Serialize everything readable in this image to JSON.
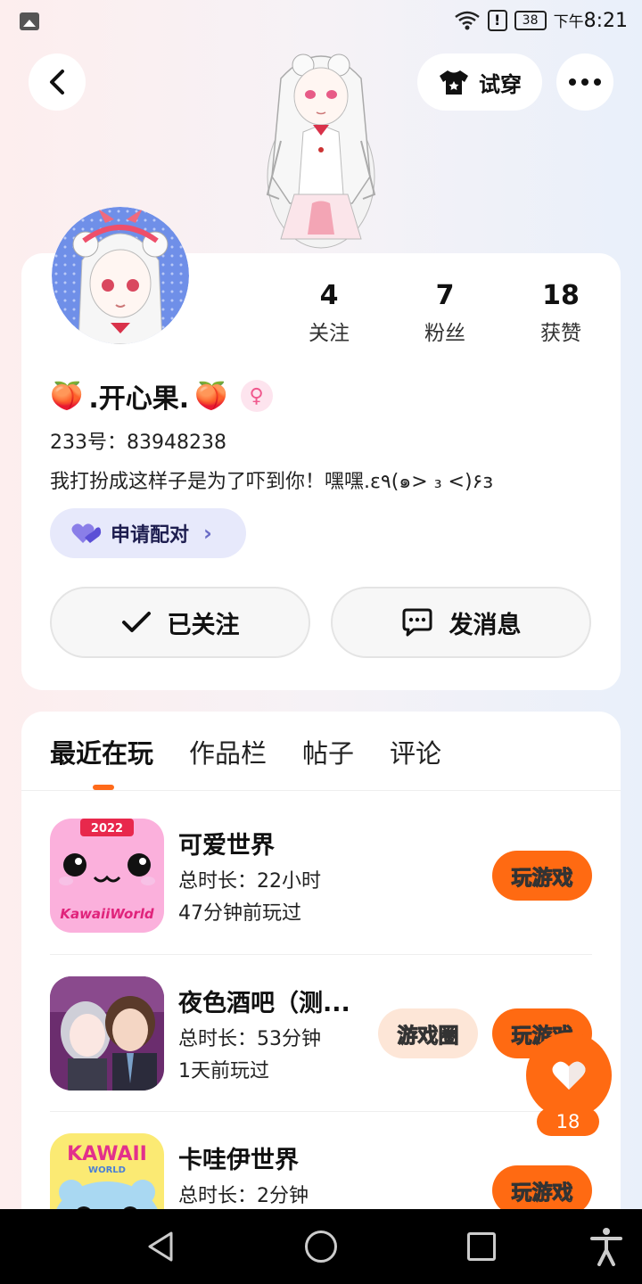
{
  "status_bar": {
    "time_prefix": "下午",
    "time": "8:21",
    "battery": "38",
    "alert": "!"
  },
  "header": {
    "try_on_label": "试穿",
    "icons": [
      "back-icon",
      "tshirt-icon",
      "more-icon"
    ]
  },
  "profile": {
    "stats": [
      {
        "value": "4",
        "label": "关注"
      },
      {
        "value": "7",
        "label": "粉丝"
      },
      {
        "value": "18",
        "label": "获赞"
      }
    ],
    "name_emoji": "🍑",
    "name": ".开心果.",
    "gender_symbol": "♀",
    "uid": "233号：83948238",
    "bio": "我打扮成这样子是为了吓到你！嘿嘿.ε٩(๑> ₃ <)۶з",
    "pair_label": "申请配对",
    "follow_label": "已关注",
    "message_label": "发消息"
  },
  "tabs": [
    {
      "label": "最近在玩",
      "active": true
    },
    {
      "label": "作品栏",
      "active": false
    },
    {
      "label": "帖子",
      "active": false
    },
    {
      "label": "评论",
      "active": false
    }
  ],
  "games": [
    {
      "title": "可爱世界",
      "duration": "总时长：22小时",
      "last_played": "47分钟前玩过",
      "play_label": "玩游戏",
      "icon_text": "2022",
      "icon_caption": "KawaiiWorld"
    },
    {
      "title": "夜色酒吧（测...",
      "duration": "总时长：53分钟",
      "last_played": "1天前玩过",
      "play_label": "玩游戏",
      "circle_label": "游戏圈"
    },
    {
      "title": "卡哇伊世界",
      "duration": "总时长：2分钟",
      "play_label": "玩游戏",
      "icon_text": "KAWAII",
      "icon_sub": "WORLD"
    }
  ],
  "like": {
    "count": "18"
  },
  "colors": {
    "accent": "#ff6a12",
    "pair_bg": "#e7e9fb",
    "gender": "#f0588d"
  }
}
